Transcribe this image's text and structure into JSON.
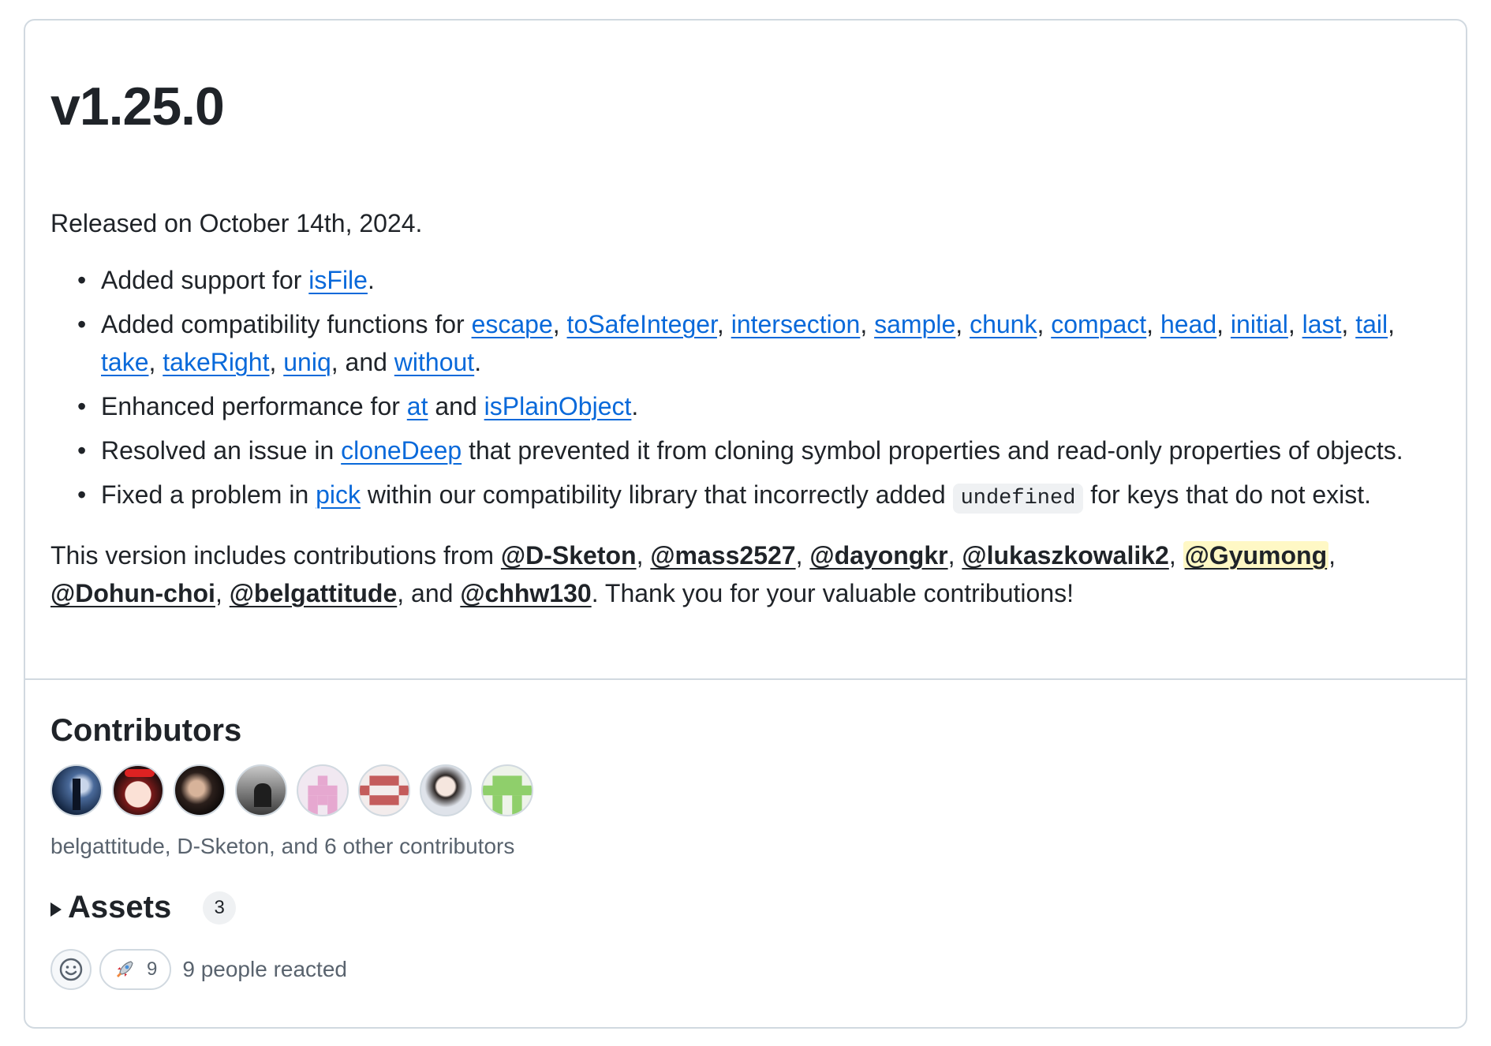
{
  "release": {
    "title": "v1.25.0",
    "released": "Released on October 14th, 2024."
  },
  "changes": {
    "c1": {
      "pre": "Added support for ",
      "links": [
        "isFile"
      ],
      "post": "."
    },
    "c2": {
      "pre": "Added compatibility functions for ",
      "links": [
        "escape",
        "toSafeInteger",
        "intersection",
        "sample",
        "chunk",
        "compact",
        "head",
        "initial",
        "last",
        "tail",
        "take",
        "takeRight",
        "uniq",
        "without"
      ],
      "sep": ", ",
      "and": ", and ",
      "post": "."
    },
    "c3": {
      "pre": "Enhanced performance for ",
      "links": [
        "at",
        "isPlainObject"
      ],
      "mid": " and ",
      "post": "."
    },
    "c4": {
      "pre": "Resolved an issue in ",
      "links": [
        "cloneDeep"
      ],
      "post": " that prevented it from cloning symbol properties and read-only properties of objects."
    },
    "c5": {
      "pre": "Fixed a problem in ",
      "links": [
        "pick"
      ],
      "mid": " within our compatibility library that incorrectly added ",
      "code": "undefined",
      "post": " for keys that do not exist."
    }
  },
  "contributions": {
    "pre": "This version includes contributions from ",
    "users": [
      "@D-Sketon",
      "@mass2527",
      "@dayongkr",
      "@lukaszkowalik2",
      "@Gyumong",
      "@Dohun-choi",
      "@belgattitude",
      "@chhw130"
    ],
    "sep": ", ",
    "and": ", and ",
    "post": ". Thank you for your valuable contributions!"
  },
  "contributors_section": {
    "title": "Contributors",
    "summary": "belgattitude, D-Sketon, and 6 other contributors",
    "avatars": [
      "avatar-1",
      "avatar-2",
      "avatar-3",
      "avatar-4",
      "avatar-5",
      "avatar-6",
      "avatar-7",
      "avatar-8"
    ]
  },
  "assets": {
    "title": "Assets",
    "count": "3"
  },
  "reactions": {
    "emoji": "rocket-icon",
    "count": "9",
    "summary": "9 people reacted"
  },
  "colors": {
    "link": "#0969da",
    "text": "#1f2328",
    "muted": "#59636e",
    "border": "#d1d9e0",
    "highlight": "#fff8c5"
  }
}
